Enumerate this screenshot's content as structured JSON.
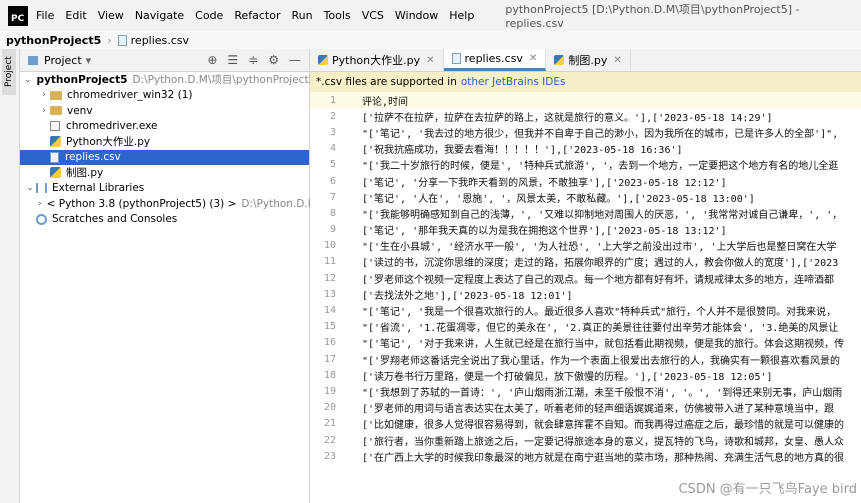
{
  "menu": {
    "items": [
      "File",
      "Edit",
      "View",
      "Navigate",
      "Code",
      "Refactor",
      "Run",
      "Tools",
      "VCS",
      "Window",
      "Help"
    ],
    "window_title": "pythonProject5 [D:\\Python.D.M\\项目\\pythonProject5] - replies.csv",
    "logo_text": "PC"
  },
  "breadcrumb": {
    "project": "pythonProject5",
    "file": "replies.csv"
  },
  "stripe": {
    "label": "Project"
  },
  "project_panel": {
    "title": "Project",
    "tree": [
      {
        "label": "pythonProject5",
        "hint": "D:\\Python.D.M\\项目\\pythonProject5",
        "level": 0,
        "kind": "folder-blue",
        "arrow": "v"
      },
      {
        "label": "chromedriver_win32 (1)",
        "level": 1,
        "kind": "folder",
        "arrow": ">"
      },
      {
        "label": "venv",
        "level": 1,
        "kind": "folder",
        "arrow": ">"
      },
      {
        "label": "chromedriver.exe",
        "level": 1,
        "kind": "exe",
        "arrow": ""
      },
      {
        "label": "Python大作业.py",
        "level": 1,
        "kind": "py",
        "arrow": ""
      },
      {
        "label": "replies.csv",
        "level": 1,
        "kind": "csv",
        "arrow": "",
        "selected": true
      },
      {
        "label": "制图.py",
        "level": 1,
        "kind": "py",
        "arrow": ""
      },
      {
        "label": "External Libraries",
        "level": 0,
        "kind": "lib",
        "arrow": "v"
      },
      {
        "label": "< Python 3.8 (pythonProject5) (3) >",
        "hint": "D:\\Python.D.M\\py",
        "level": 1,
        "kind": "py",
        "arrow": ">"
      },
      {
        "label": "Scratches and Consoles",
        "level": 0,
        "kind": "scratch",
        "arrow": ""
      }
    ]
  },
  "editor": {
    "tabs": [
      {
        "label": "Python大作业.py",
        "kind": "py",
        "active": false
      },
      {
        "label": "replies.csv",
        "kind": "csv",
        "active": true
      },
      {
        "label": "制图.py",
        "kind": "py",
        "active": false
      }
    ],
    "banner": {
      "text": "*.csv files are supported in",
      "link": "other JetBrains IDEs"
    },
    "lines": [
      "评论,时间",
      "['拉萨不在拉萨，拉萨在去拉萨的路上，这就是旅行的意义。'],['2023-05-18 14:29']",
      "\"['笔记', '我去过的地方很少，但我并不自卑于自己的渺小，因为我所在的城市，已是许多人的全部']\",",
      "['祝我抗癌成功，我要去看海！！！！！'],['2023-05-18 16:36']",
      "\"['我二十岁旅行的时候，便是', '特种兵式旅游', '，去到一个地方，一定要把这个地方有名的地儿全逛",
      "['笔记', '分享一下我昨天看到的风景，不敢独享'],['2023-05-18 12:12']",
      "['笔记', '人在', '恩施', '，风景太美，不敢私藏。'],['2023-05-18 13:00']",
      "\"['我能够明确感知到自己的浅薄，', '又难以抑制地对周围人的厌恶，', '我常常对诚自己谦卑，', '，",
      "['笔记', '那年我天真的以为是我在拥抱这个世界'],['2023-05-18 13:12']",
      "\"['生在小县城', '经济水平一般', '为人社恐', '上大学之前没出过市', '上大学后也是整日窝在大学",
      "['读过的书，沉淀你思维的深度；走过的路，拓展你眼界的广度；遇过的人，教会你做人的宽度'],['2023",
      "['罗老师这个视频一定程度上表达了自己的观点。每一个地方都有好有坏，请规戒律太多的地方，连啼酒都",
      "['去找法外之地'],['2023-05-18 12:01']",
      "\"['笔记', '我是一个很喜欢旅行的人。最近很多人喜欢\"特种兵式\"旅行，个人并不是很赞同。对我来说，",
      "\"['省流', '1.花蛋凋零，但它的美永在', '2.真正的美景往往要付出辛劳才能体会', '3.绝美的风景让",
      "\"['笔记', '对于我来讲，人生就已经是在旅行当中，就包括看此期视频，便是我的旅行。体会这期视频，传",
      "\"['罗翔老师这番话完全说出了我心里话，作为一个表面上很爱出去旅行的人，我确实有一颗很喜欢看风景的",
      "['读万卷书行万里路，便是一个打破偏见，放下傲慢的历程。'],['2023-05-18 12:05']",
      "\"['我想到了苏轼的一首诗：', '庐山烟雨浙江潮，未至千般恨不消', '。', '到得还来别无事，庐山烟雨",
      "['罗老师的用词与语言表达实在太美了，听着老师的轻声细语娓娓道来，仿佛被带入进了某种意境当中，跟",
      "['比如健康，很多人觉得很容易得到，就会肆意挥霍不自知。而我再得过癌症之后，最珍惜的就是可以健康的",
      "['旅行者，当你重新踏上旅途之后，一定要记得旅途本身的意义，提瓦特的飞鸟，诗歌和城邦，女皇、愚人众",
      "['在广西上大学的时候我印象最深的地方就是在南宁逛当地的菜市场，那种热闹、充满生活气息的地方真的很"
    ]
  },
  "watermark": "CSDN @有一只飞鸟Faye bird"
}
